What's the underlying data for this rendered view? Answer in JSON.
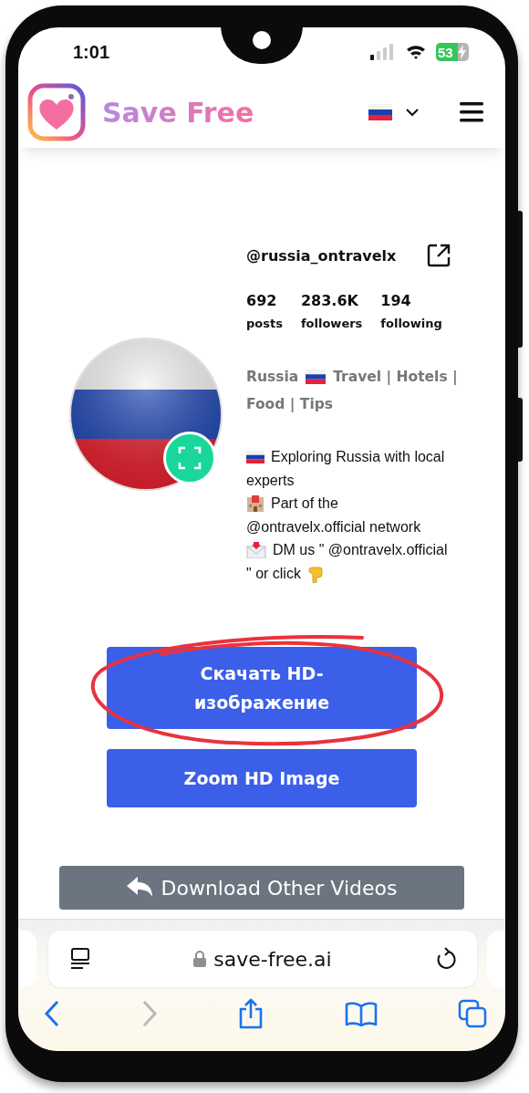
{
  "status_bar": {
    "time": "1:01",
    "battery": "53",
    "charging": true
  },
  "header": {
    "brand": "Save Free"
  },
  "profile": {
    "username": "@russia_ontravelx",
    "stats": [
      {
        "value": "692",
        "label": "posts"
      },
      {
        "value": "283.6K",
        "label": "followers"
      },
      {
        "value": "194",
        "label": "following"
      }
    ],
    "bio_title": [
      "Russia",
      "Travel | Hotels |",
      "Food | Tips"
    ],
    "bio_lines": [
      [
        "Exploring Russia with local",
        "experts"
      ],
      [
        "Part of the",
        "@ontravelx.official network"
      ],
      [
        "DM us \" @ontravelx.official",
        "\" or click"
      ]
    ]
  },
  "actions": [
    {
      "label": "Скачать HD-изображение",
      "highlighted": true
    },
    {
      "label": "Zoom HD Image",
      "highlighted": false
    }
  ],
  "secondary_action": {
    "label": "Download Other Videos"
  },
  "browser": {
    "url": "save-free.ai",
    "nav": [
      {
        "kind": "back",
        "disabled": false
      },
      {
        "kind": "forward",
        "disabled": true
      },
      {
        "kind": "share",
        "disabled": false
      },
      {
        "kind": "bookmarks",
        "disabled": false
      },
      {
        "kind": "tabs",
        "disabled": false
      }
    ]
  }
}
